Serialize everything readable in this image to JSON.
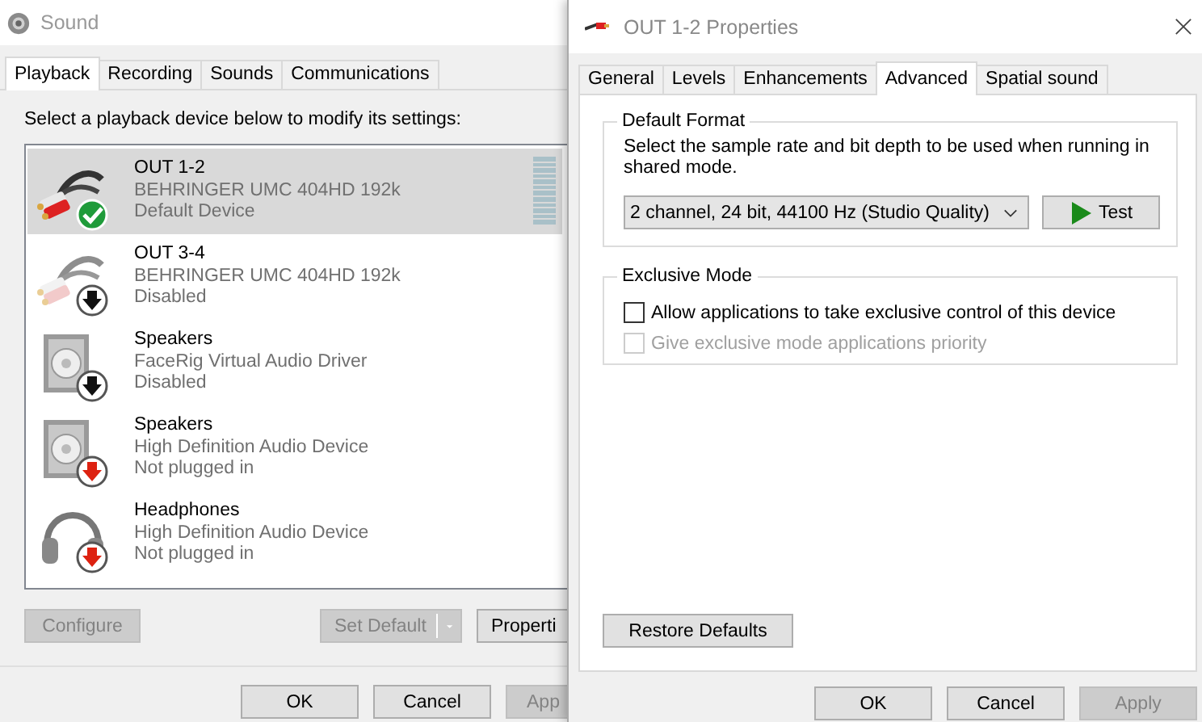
{
  "sound_window": {
    "title": "Sound",
    "tabs": [
      {
        "label": "Playback",
        "selected": true
      },
      {
        "label": "Recording",
        "selected": false
      },
      {
        "label": "Sounds",
        "selected": false
      },
      {
        "label": "Communications",
        "selected": false
      }
    ],
    "instruction": "Select a playback device below to modify its settings:",
    "devices": [
      {
        "name": "OUT 1-2",
        "driver": "BEHRINGER UMC 404HD 192k",
        "status": "Default Device",
        "kind": "cable",
        "default": true,
        "disabled": false,
        "unplugged": false,
        "selected": true
      },
      {
        "name": "OUT 3-4",
        "driver": "BEHRINGER UMC 404HD 192k",
        "status": "Disabled",
        "kind": "cable",
        "default": false,
        "disabled": true,
        "unplugged": false,
        "selected": false
      },
      {
        "name": "Speakers",
        "driver": "FaceRig Virtual Audio Driver",
        "status": "Disabled",
        "kind": "speaker",
        "default": false,
        "disabled": true,
        "unplugged": false,
        "selected": false
      },
      {
        "name": "Speakers",
        "driver": "High Definition Audio Device",
        "status": "Not plugged in",
        "kind": "speaker",
        "default": false,
        "disabled": false,
        "unplugged": true,
        "selected": false
      },
      {
        "name": "Headphones",
        "driver": "High Definition Audio Device",
        "status": "Not plugged in",
        "kind": "headphones",
        "default": false,
        "disabled": false,
        "unplugged": true,
        "selected": false
      }
    ],
    "buttons": [
      {
        "label": "Configure",
        "disabled": true,
        "kind": "plain"
      },
      {
        "label": "Set Default",
        "disabled": true,
        "kind": "split"
      },
      {
        "label": "Properti",
        "disabled": false,
        "kind": "plain"
      }
    ],
    "dialog_buttons": [
      {
        "label": "OK",
        "disabled": false
      },
      {
        "label": "Cancel",
        "disabled": false
      },
      {
        "label": "App",
        "disabled": true
      }
    ]
  },
  "properties_window": {
    "title": "OUT 1-2 Properties",
    "tabs": [
      {
        "label": "General",
        "selected": false
      },
      {
        "label": "Levels",
        "selected": false
      },
      {
        "label": "Enhancements",
        "selected": false
      },
      {
        "label": "Advanced",
        "selected": true
      },
      {
        "label": "Spatial sound",
        "selected": false
      }
    ],
    "default_format": {
      "heading": "Default Format",
      "description": "Select the sample rate and bit depth to be used when running in shared mode.",
      "format_value": "2 channel, 24 bit, 44100 Hz (Studio Quality)",
      "test_button": "Test"
    },
    "exclusive_mode": {
      "heading": "Exclusive Mode",
      "options": [
        {
          "label": "Allow applications to take exclusive control of this device",
          "checked": false,
          "disabled": false
        },
        {
          "label": "Give exclusive mode applications priority",
          "checked": false,
          "disabled": true
        }
      ]
    },
    "restore_button": "Restore Defaults",
    "dialog_buttons": [
      {
        "label": "OK",
        "disabled": false
      },
      {
        "label": "Cancel",
        "disabled": false
      },
      {
        "label": "Apply",
        "disabled": true
      }
    ]
  }
}
